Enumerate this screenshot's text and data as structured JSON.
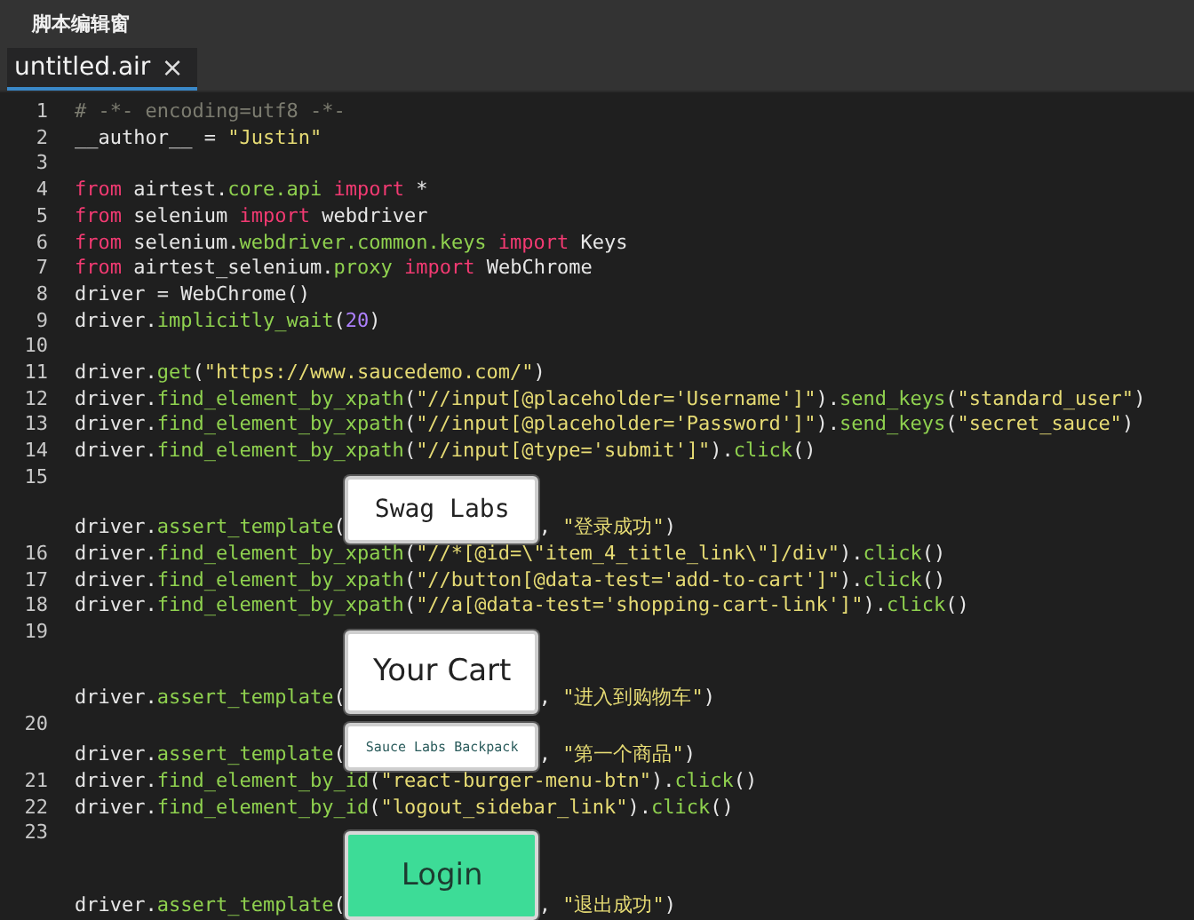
{
  "window": {
    "title": "脚本编辑窗"
  },
  "tabs": [
    {
      "label": "untitled.air",
      "close": "×",
      "selected": true
    }
  ],
  "lines": [
    {
      "number": "1",
      "kind": "code",
      "tokens": [
        {
          "kind": "comment",
          "text": "# -*- encoding=utf8 -*-"
        }
      ]
    },
    {
      "number": "2",
      "kind": "code",
      "tokens": [
        {
          "kind": "plain",
          "text": "__author__ = "
        },
        {
          "kind": "string",
          "text": "\"Justin\""
        }
      ]
    },
    {
      "number": "3",
      "kind": "blank"
    },
    {
      "number": "4",
      "kind": "code",
      "tokens": [
        {
          "kind": "keyword",
          "text": "from"
        },
        {
          "kind": "plain",
          "text": " airtest."
        },
        {
          "kind": "module",
          "text": "core.api"
        },
        {
          "kind": "keyword",
          "text": " import"
        },
        {
          "kind": "plain",
          "text": " *"
        }
      ]
    },
    {
      "number": "5",
      "kind": "code",
      "tokens": [
        {
          "kind": "keyword",
          "text": "from"
        },
        {
          "kind": "plain",
          "text": " selenium "
        },
        {
          "kind": "keyword",
          "text": "import"
        },
        {
          "kind": "plain",
          "text": " webdriver"
        }
      ]
    },
    {
      "number": "6",
      "kind": "code",
      "tokens": [
        {
          "kind": "keyword",
          "text": "from"
        },
        {
          "kind": "plain",
          "text": " selenium."
        },
        {
          "kind": "module",
          "text": "webdriver.common.keys"
        },
        {
          "kind": "keyword",
          "text": " import"
        },
        {
          "kind": "plain",
          "text": " Keys"
        }
      ]
    },
    {
      "number": "7",
      "kind": "code",
      "tokens": [
        {
          "kind": "keyword",
          "text": "from"
        },
        {
          "kind": "plain",
          "text": " airtest_selenium."
        },
        {
          "kind": "module",
          "text": "proxy"
        },
        {
          "kind": "keyword",
          "text": " import"
        },
        {
          "kind": "plain",
          "text": " WebChrome"
        }
      ]
    },
    {
      "number": "8",
      "kind": "code",
      "tokens": [
        {
          "kind": "plain",
          "text": "driver = WebChrome()"
        }
      ]
    },
    {
      "number": "9",
      "kind": "code",
      "tokens": [
        {
          "kind": "plain",
          "text": "driver."
        },
        {
          "kind": "func",
          "text": "implicitly_wait"
        },
        {
          "kind": "plain",
          "text": "("
        },
        {
          "kind": "number",
          "text": "20"
        },
        {
          "kind": "plain",
          "text": ")"
        }
      ]
    },
    {
      "number": "10",
      "kind": "blank"
    },
    {
      "number": "11",
      "kind": "code",
      "tokens": [
        {
          "kind": "plain",
          "text": "driver."
        },
        {
          "kind": "func",
          "text": "get"
        },
        {
          "kind": "plain",
          "text": "("
        },
        {
          "kind": "string",
          "text": "\"https://www.saucedemo.com/\""
        },
        {
          "kind": "plain",
          "text": ")"
        }
      ]
    },
    {
      "number": "12",
      "kind": "code",
      "tokens": [
        {
          "kind": "plain",
          "text": "driver."
        },
        {
          "kind": "func",
          "text": "find_element_by_xpath"
        },
        {
          "kind": "plain",
          "text": "("
        },
        {
          "kind": "string",
          "text": "\"//input[@placeholder='Username']\""
        },
        {
          "kind": "plain",
          "text": ")."
        },
        {
          "kind": "func",
          "text": "send_keys"
        },
        {
          "kind": "plain",
          "text": "("
        },
        {
          "kind": "string",
          "text": "\"standard_user\""
        },
        {
          "kind": "plain",
          "text": ")"
        }
      ]
    },
    {
      "number": "13",
      "kind": "code",
      "tokens": [
        {
          "kind": "plain",
          "text": "driver."
        },
        {
          "kind": "func",
          "text": "find_element_by_xpath"
        },
        {
          "kind": "plain",
          "text": "("
        },
        {
          "kind": "string",
          "text": "\"//input[@placeholder='Password']\""
        },
        {
          "kind": "plain",
          "text": ")."
        },
        {
          "kind": "func",
          "text": "send_keys"
        },
        {
          "kind": "plain",
          "text": "("
        },
        {
          "kind": "string",
          "text": "\"secret_sauce\""
        },
        {
          "kind": "plain",
          "text": ")"
        }
      ]
    },
    {
      "number": "14",
      "kind": "code",
      "tokens": [
        {
          "kind": "plain",
          "text": "driver."
        },
        {
          "kind": "func",
          "text": "find_element_by_xpath"
        },
        {
          "kind": "plain",
          "text": "("
        },
        {
          "kind": "string",
          "text": "\"//input[@type='submit']\""
        },
        {
          "kind": "plain",
          "text": ")."
        },
        {
          "kind": "func",
          "text": "click"
        },
        {
          "kind": "plain",
          "text": "()"
        }
      ]
    },
    {
      "number": "15",
      "kind": "template",
      "tokens": [
        {
          "kind": "plain",
          "text": "driver."
        },
        {
          "kind": "func",
          "text": "assert_template"
        },
        {
          "kind": "plain",
          "text": "("
        }
      ],
      "template": {
        "label": "Swag Labs",
        "kind": "logo"
      },
      "after": [
        {
          "kind": "plain",
          "text": ", "
        },
        {
          "kind": "string",
          "text": "\"登录成功\""
        },
        {
          "kind": "plain",
          "text": ")"
        }
      ]
    },
    {
      "number": "16",
      "kind": "code",
      "tokens": [
        {
          "kind": "plain",
          "text": "driver."
        },
        {
          "kind": "func",
          "text": "find_element_by_xpath"
        },
        {
          "kind": "plain",
          "text": "("
        },
        {
          "kind": "string",
          "text": "\"//*[@id=\\\"item_4_title_link\\\"]/div\""
        },
        {
          "kind": "plain",
          "text": ")."
        },
        {
          "kind": "func",
          "text": "click"
        },
        {
          "kind": "plain",
          "text": "()"
        }
      ]
    },
    {
      "number": "17",
      "kind": "code",
      "tokens": [
        {
          "kind": "plain",
          "text": "driver."
        },
        {
          "kind": "func",
          "text": "find_element_by_xpath"
        },
        {
          "kind": "plain",
          "text": "("
        },
        {
          "kind": "string",
          "text": "\"//button[@data-test='add-to-cart']\""
        },
        {
          "kind": "plain",
          "text": ")."
        },
        {
          "kind": "func",
          "text": "click"
        },
        {
          "kind": "plain",
          "text": "()"
        }
      ]
    },
    {
      "number": "18",
      "kind": "code",
      "tokens": [
        {
          "kind": "plain",
          "text": "driver."
        },
        {
          "kind": "func",
          "text": "find_element_by_xpath"
        },
        {
          "kind": "plain",
          "text": "("
        },
        {
          "kind": "string",
          "text": "\"//a[@data-test='shopping-cart-link']\""
        },
        {
          "kind": "plain",
          "text": ")."
        },
        {
          "kind": "func",
          "text": "click"
        },
        {
          "kind": "plain",
          "text": "()"
        }
      ]
    },
    {
      "number": "19",
      "kind": "template",
      "tokens": [
        {
          "kind": "plain",
          "text": "driver."
        },
        {
          "kind": "func",
          "text": "assert_template"
        },
        {
          "kind": "plain",
          "text": "("
        }
      ],
      "template": {
        "label": "Your Cart",
        "kind": "heading"
      },
      "after": [
        {
          "kind": "plain",
          "text": ", "
        },
        {
          "kind": "string",
          "text": "\"进入到购物车\""
        },
        {
          "kind": "plain",
          "text": ")"
        }
      ]
    },
    {
      "number": "20",
      "kind": "template",
      "tokens": [
        {
          "kind": "plain",
          "text": "driver."
        },
        {
          "kind": "func",
          "text": "assert_template"
        },
        {
          "kind": "plain",
          "text": "("
        }
      ],
      "template": {
        "label": "Sauce Labs Backpack",
        "kind": "label"
      },
      "after": [
        {
          "kind": "plain",
          "text": ", "
        },
        {
          "kind": "string",
          "text": "\"第一个商品\""
        },
        {
          "kind": "plain",
          "text": ")"
        }
      ]
    },
    {
      "number": "21",
      "kind": "code",
      "tokens": [
        {
          "kind": "plain",
          "text": "driver."
        },
        {
          "kind": "func",
          "text": "find_element_by_id"
        },
        {
          "kind": "plain",
          "text": "("
        },
        {
          "kind": "string",
          "text": "\"react-burger-menu-btn\""
        },
        {
          "kind": "plain",
          "text": ")."
        },
        {
          "kind": "func",
          "text": "click"
        },
        {
          "kind": "plain",
          "text": "()"
        }
      ]
    },
    {
      "number": "22",
      "kind": "code",
      "tokens": [
        {
          "kind": "plain",
          "text": "driver."
        },
        {
          "kind": "func",
          "text": "find_element_by_id"
        },
        {
          "kind": "plain",
          "text": "("
        },
        {
          "kind": "string",
          "text": "\"logout_sidebar_link\""
        },
        {
          "kind": "plain",
          "text": ")."
        },
        {
          "kind": "func",
          "text": "click"
        },
        {
          "kind": "plain",
          "text": "()"
        }
      ]
    },
    {
      "number": "23",
      "kind": "template",
      "tokens": [
        {
          "kind": "plain",
          "text": "driver."
        },
        {
          "kind": "func",
          "text": "assert_template"
        },
        {
          "kind": "plain",
          "text": "("
        }
      ],
      "template": {
        "label": "Login",
        "kind": "button"
      },
      "after": [
        {
          "kind": "plain",
          "text": ", "
        },
        {
          "kind": "string",
          "text": "\"退出成功\""
        },
        {
          "kind": "plain",
          "text": ")"
        }
      ]
    }
  ]
}
